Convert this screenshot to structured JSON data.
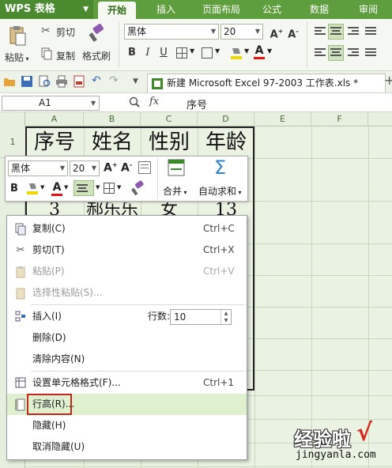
{
  "app": {
    "name": "WPS 表格",
    "tabs": [
      "开始",
      "插入",
      "页面布局",
      "公式",
      "数据",
      "审阅"
    ],
    "active_tab": "开始"
  },
  "ribbon": {
    "paste": "粘贴",
    "cut": "剪切",
    "copy": "复制",
    "format_painter": "格式刷",
    "font_name": "黑体",
    "font_size": "20",
    "bold": "B",
    "italic": "I",
    "underline": "U",
    "font_color_letter": "A",
    "grow_font": "A",
    "shrink_font": "A"
  },
  "document": {
    "tab_title": "新建 Microsoft Excel 97-2003 工作表.xls *"
  },
  "formula_bar": {
    "name_box": "A1",
    "fx": "fx",
    "content": "序号"
  },
  "sheet": {
    "columns": [
      "A",
      "B",
      "C",
      "D",
      "E",
      "F"
    ],
    "rows": [
      "1"
    ],
    "header_row": [
      "序号",
      "姓名",
      "性别",
      "年龄"
    ],
    "partial_row": [
      "3",
      "郝乐乐",
      "女",
      "13"
    ]
  },
  "mini_toolbar": {
    "font_name": "黑体",
    "font_size": "20",
    "bold": "B",
    "merge": "合并",
    "autosum": "自动求和",
    "sigma": "Σ"
  },
  "context_menu": {
    "items": [
      {
        "label": "复制(C)",
        "shortcut": "Ctrl+C"
      },
      {
        "label": "剪切(T)",
        "shortcut": "Ctrl+X"
      },
      {
        "label": "粘贴(P)",
        "shortcut": "Ctrl+V"
      },
      {
        "label": "选择性粘贴(S)..."
      },
      {
        "label": "插入(I)",
        "extra_label": "行数:",
        "extra_value": "10"
      },
      {
        "label": "删除(D)"
      },
      {
        "label": "清除内容(N)"
      },
      {
        "label": "设置单元格格式(F)...",
        "shortcut": "Ctrl+1"
      },
      {
        "label": "行高(R)..."
      },
      {
        "label": "隐藏(H)"
      },
      {
        "label": "取消隐藏(U)"
      }
    ]
  },
  "watermark": {
    "title": "经验啦",
    "check": "√",
    "url": "jingyanla.com"
  },
  "colors": {
    "title_bar": "#5f9e3e",
    "grid_fill": "#eaf3e1",
    "highlight": "#dff0cf",
    "red_box": "#c0281e"
  }
}
